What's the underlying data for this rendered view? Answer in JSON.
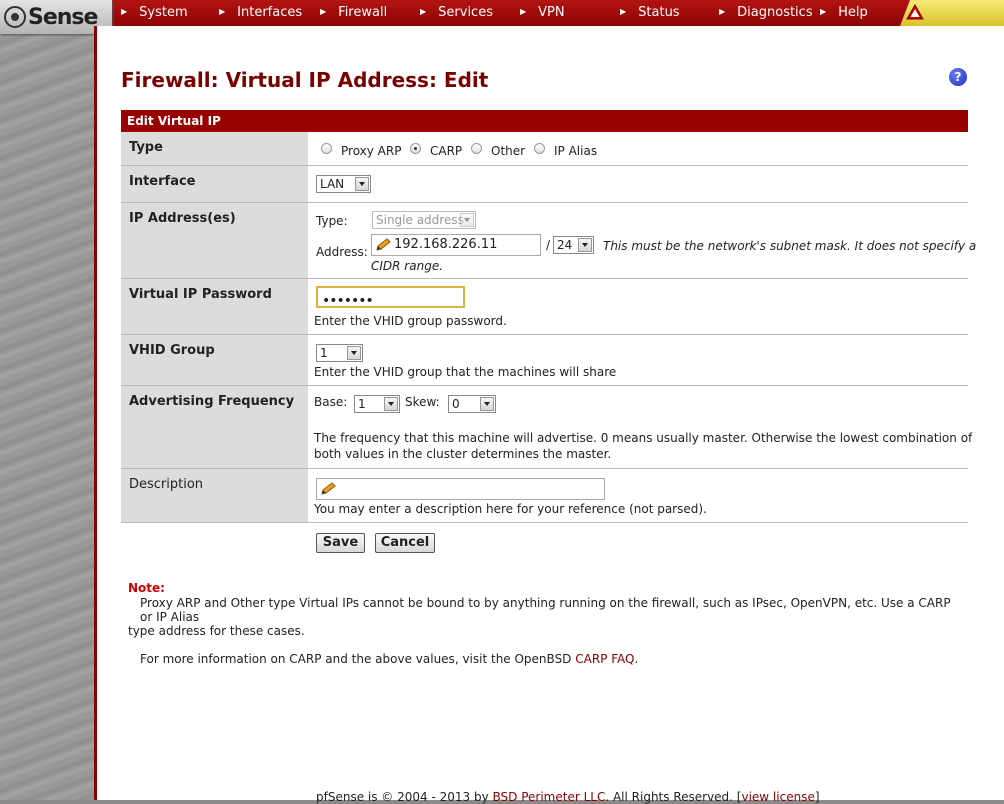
{
  "app": {
    "logo": "Sense"
  },
  "nav": {
    "items": [
      {
        "label": "System"
      },
      {
        "label": "Interfaces"
      },
      {
        "label": "Firewall"
      },
      {
        "label": "Services"
      },
      {
        "label": "VPN"
      },
      {
        "label": "Status"
      },
      {
        "label": "Diagnostics"
      },
      {
        "label": "Help"
      }
    ]
  },
  "page": {
    "title": "Firewall: Virtual IP Address: Edit",
    "help": "?"
  },
  "section": {
    "header": "Edit Virtual IP"
  },
  "form": {
    "type": {
      "label": "Type",
      "options": [
        {
          "label": "Proxy ARP",
          "selected": false
        },
        {
          "label": "CARP",
          "selected": true
        },
        {
          "label": "Other",
          "selected": false
        },
        {
          "label": "IP Alias",
          "selected": false
        }
      ]
    },
    "interface": {
      "label": "Interface",
      "value": "LAN"
    },
    "ip": {
      "label": "IP Address(es)",
      "type_label": "Type:",
      "type_value": "Single address",
      "address_label": "Address:",
      "address_value": "192.168.226.11",
      "slash": "/",
      "mask_value": "24",
      "hint_line1": "This must be the network's subnet mask. It does not specify a",
      "hint_line2": "CIDR range."
    },
    "password": {
      "label": "Virtual IP Password",
      "value": "•••••••",
      "hint": "Enter the VHID group password."
    },
    "vhid": {
      "label": "VHID Group",
      "value": "1",
      "hint": "Enter the VHID group that the machines will share"
    },
    "advfreq": {
      "label": "Advertising Frequency",
      "base_label": "Base:",
      "base_value": "1",
      "skew_label": "Skew:",
      "skew_value": "0",
      "hint_line1": "The frequency that this machine will advertise. 0 means usually master. Otherwise the lowest combination of",
      "hint_line2": "both values in the cluster determines the master."
    },
    "description": {
      "label": "Description",
      "value": "",
      "hint": "You may enter a description here for your reference (not parsed)."
    },
    "save_label": "Save",
    "cancel_label": "Cancel"
  },
  "note": {
    "title": "Note:",
    "line1": "Proxy ARP and Other type Virtual IPs cannot be bound to by anything running on the firewall, such as IPsec, OpenVPN, etc. Use a CARP or IP Alias",
    "line2": "type address for these cases.",
    "line3_prefix": "For more information on CARP and the above values, visit the OpenBSD",
    "line3_link": "CARP FAQ",
    "line3_suffix": "."
  },
  "footer": {
    "text": "pfSense is © 2004 - 2013 by",
    "company": "BSD Perimeter LLC",
    "rights": ". All Rights Reserved. [",
    "license": "view license",
    "close": "]"
  }
}
